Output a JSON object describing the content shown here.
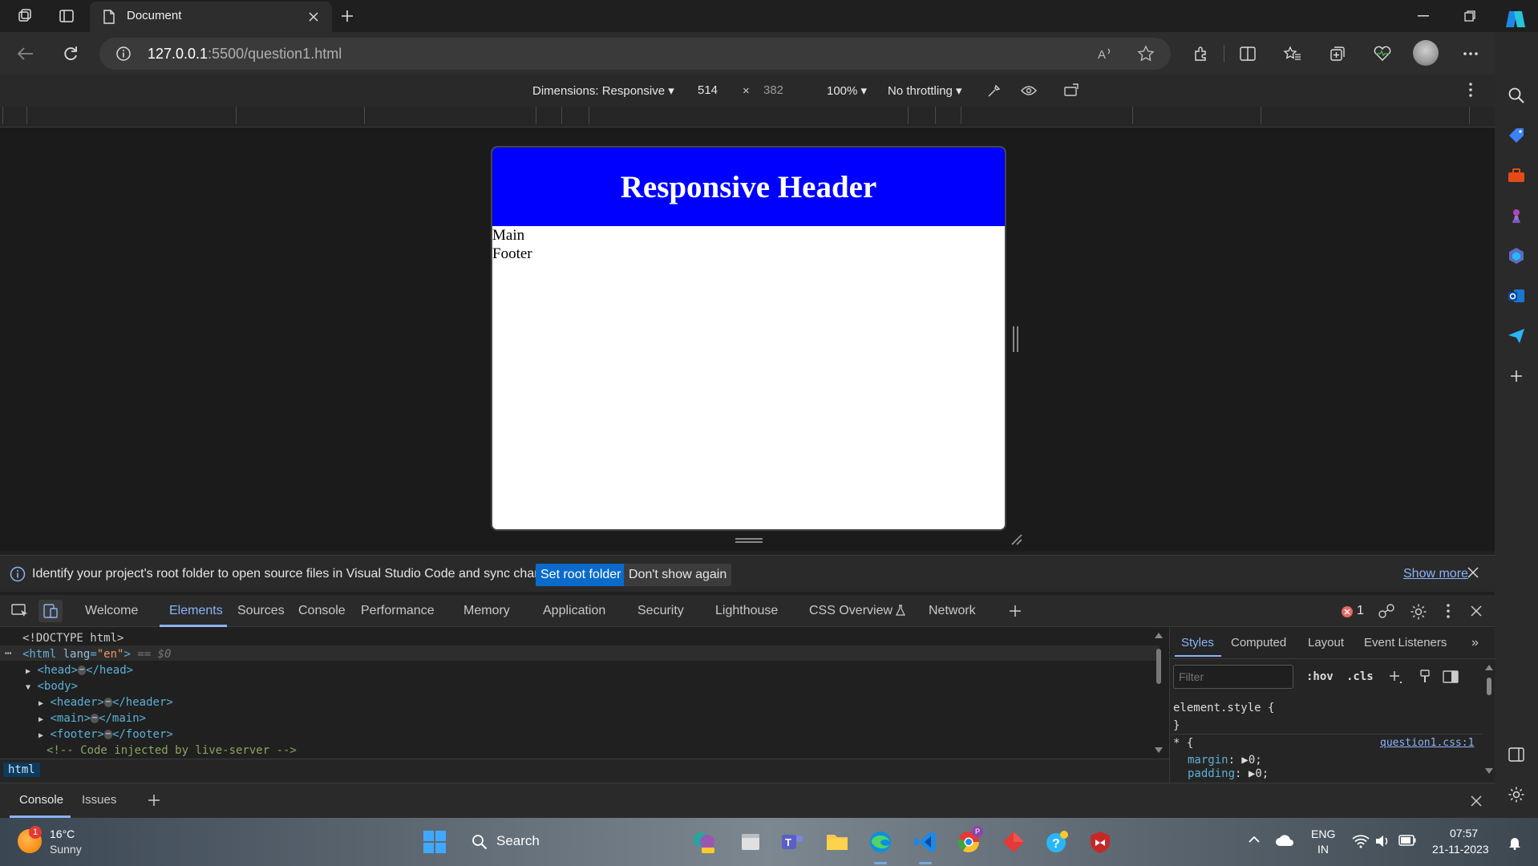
{
  "browser": {
    "tab_title": "Document",
    "url_host": "127.0.0.1",
    "url_path": ":5500/question1.html"
  },
  "device_toolbar": {
    "dimensions_label": "Dimensions: Responsive",
    "width": "514",
    "times": "×",
    "height": "382",
    "zoom": "100%",
    "throttling": "No throttling"
  },
  "page": {
    "header_title": "Responsive Header",
    "main_text": "Main",
    "footer_text": "Footer"
  },
  "infobar": {
    "message": "Identify your project's root folder to open source files in Visual Studio Code and sync changes.",
    "set_root_button": "Set root folder",
    "dont_show_button": "Don't show again",
    "show_more_link": "Show more"
  },
  "devtools": {
    "tabs": [
      "Welcome",
      "Elements",
      "Sources",
      "Console",
      "Performance",
      "Memory",
      "Application",
      "Security",
      "Lighthouse",
      "CSS Overview",
      "Network"
    ],
    "error_count": "1",
    "dom": {
      "doctype": "<!DOCTYPE html>",
      "html_open": "<html",
      "lang_attr": "lang",
      "lang_val": "\"en\"",
      "html_close": ">",
      "selected_marker": "== $0",
      "head": "<head>",
      "head_close": "</head>",
      "body": "<body>",
      "header": "<header>",
      "header_close": "</header>",
      "main": "<main>",
      "main_close": "</main>",
      "footer": "<footer>",
      "footer_close": "</footer>",
      "comment": "<!-- Code injected by live-server -->"
    },
    "breadcrumb": "html",
    "styles_tabs": [
      "Styles",
      "Computed",
      "Layout",
      "Event Listeners"
    ],
    "filter_placeholder": "Filter",
    "hov": ":hov",
    "cls": ".cls",
    "element_style": "element.style {",
    "close_brace": "}",
    "universal_selector": "* {",
    "source_link": "question1.css:1",
    "prop_margin": "margin",
    "prop_padding": "padding",
    "prop_value": "0;"
  },
  "drawer": {
    "tabs": [
      "Console",
      "Issues"
    ]
  },
  "taskbar": {
    "weather_temp": "16°C",
    "weather_desc": "Sunny",
    "weather_badge": "1",
    "search_label": "Search",
    "lang_top": "ENG",
    "lang_bottom": "IN",
    "time": "07:57",
    "date": "21-11-2023"
  },
  "colors": {
    "page_header_bg": "#0000ff",
    "accent_blue": "#8ab4f8",
    "button_blue": "#0b6bcb"
  }
}
